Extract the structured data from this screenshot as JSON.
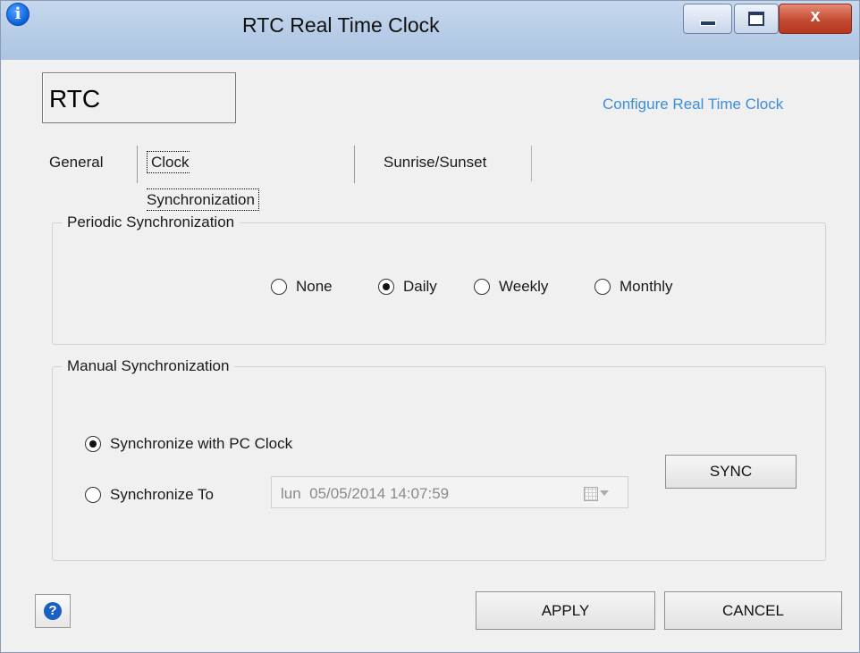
{
  "window": {
    "title": "RTC Real Time Clock",
    "icon": "info-icon",
    "controls": {
      "minimize": "minimize",
      "maximize": "maximize",
      "close": "x"
    }
  },
  "header": {
    "name": "RTC",
    "config_link": "Configure Real Time Clock"
  },
  "tabs": [
    {
      "label": "General"
    },
    {
      "label": "Clock Synchronization",
      "active": true
    },
    {
      "label": "Sunrise/Sunset"
    }
  ],
  "periodic": {
    "legend": "Periodic Synchronization",
    "options": [
      {
        "label": "None",
        "selected": false
      },
      {
        "label": "Daily",
        "selected": true
      },
      {
        "label": "Weekly",
        "selected": false
      },
      {
        "label": "Monthly",
        "selected": false
      }
    ]
  },
  "manual": {
    "legend": "Manual Synchronization",
    "option_pc": {
      "label": "Synchronize with PC Clock",
      "selected": true
    },
    "option_to": {
      "label": "Synchronize To",
      "selected": false
    },
    "date_value": "lun  05/05/2014 14:07:59",
    "sync_label": "SYNC"
  },
  "footer": {
    "help_icon": "help-icon",
    "apply_label": "APPLY",
    "cancel_label": "CANCEL"
  },
  "colors": {
    "accent_link": "#3c8ddb",
    "close_button": "#c44a31",
    "titlebar": "#b5cbe6"
  }
}
